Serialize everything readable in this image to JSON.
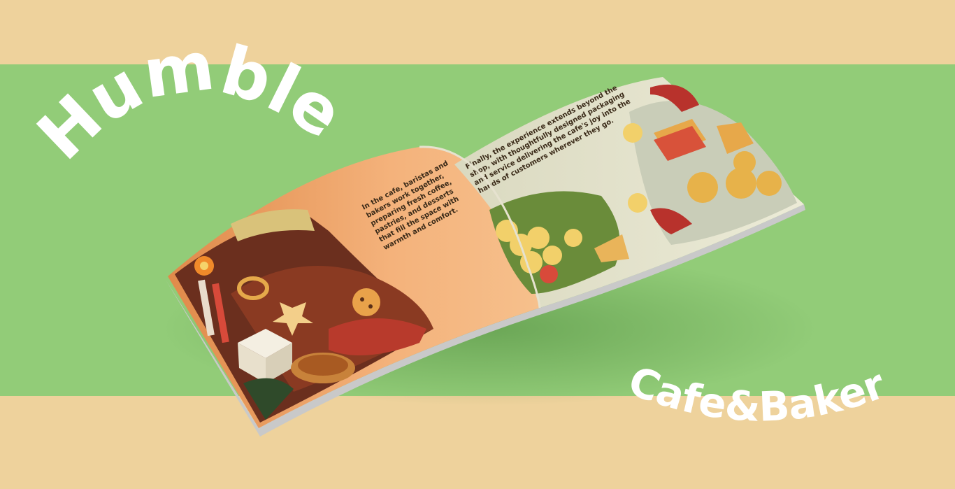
{
  "brand": {
    "title": "Humble",
    "subtitle": "Cafe&Bakery"
  },
  "book": {
    "left_page_text": "In the cafe, baristas and bakers work together, preparing fresh coffee, pastries, and desserts that fill the space with warmth and comfort.",
    "right_page_text": "Finally, the experience extends beyond the shop, with thoughtfully designed packaging and service delivering the cafe's joy into the hands of customers wherever they go."
  },
  "colors": {
    "band_tan": "#eed29c",
    "band_green": "#92cc78",
    "page_orange": "#f2b27a",
    "page_cream": "#e9e6cf",
    "text_white": "#ffffff"
  }
}
